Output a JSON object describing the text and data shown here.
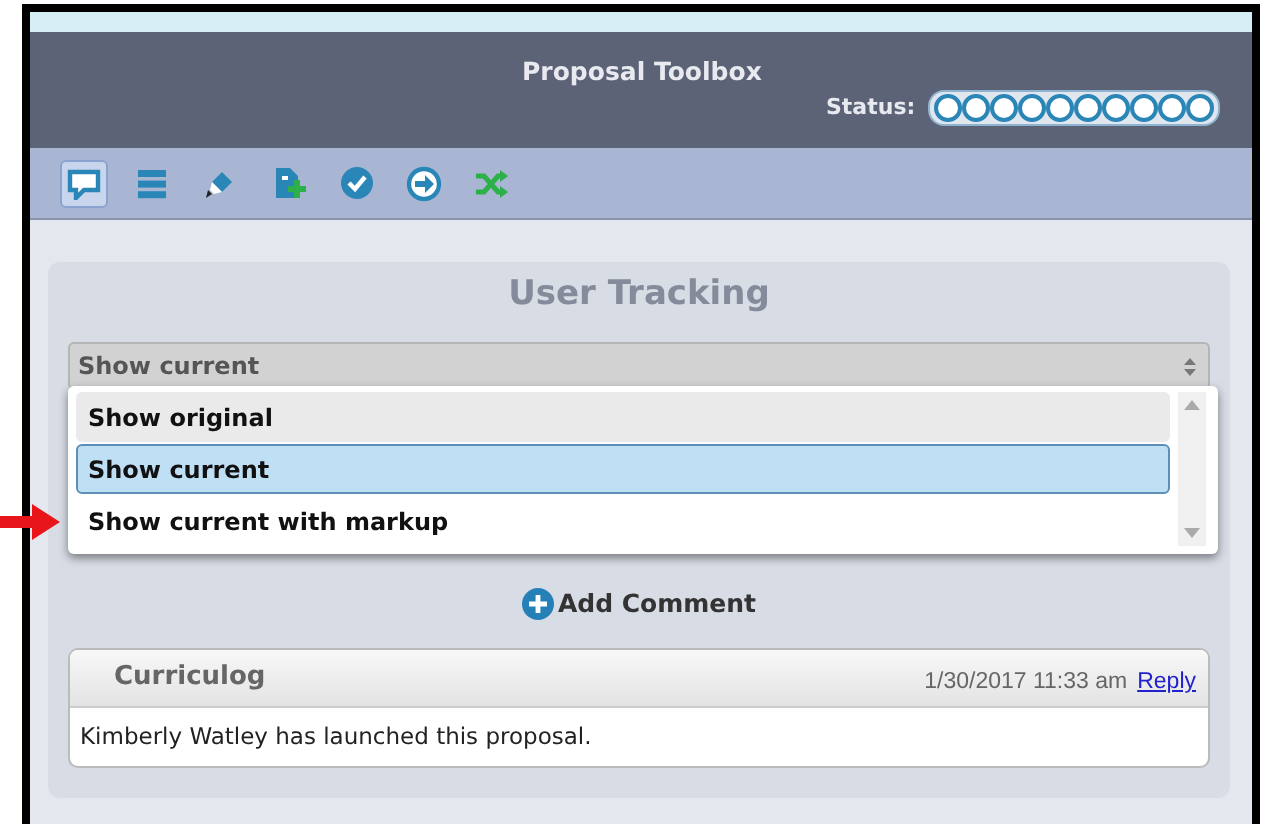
{
  "header": {
    "title": "Proposal Toolbox",
    "status_label": "Status:",
    "status_steps": [
      {
        "done": false
      },
      {
        "done": false
      },
      {
        "done": false
      },
      {
        "done": false
      },
      {
        "done": false
      },
      {
        "done": false
      },
      {
        "done": false
      },
      {
        "done": false
      },
      {
        "done": false
      },
      {
        "done": false
      }
    ]
  },
  "toolbar": [
    {
      "kind": "comment",
      "selected": true
    },
    {
      "kind": "list",
      "selected": false
    },
    {
      "kind": "pencil",
      "selected": false
    },
    {
      "kind": "add-file",
      "selected": false
    },
    {
      "kind": "check",
      "selected": false
    },
    {
      "kind": "arrow",
      "selected": false
    },
    {
      "kind": "shuffle",
      "selected": false
    }
  ],
  "panel": {
    "title": "User Tracking",
    "select_value": "Show current",
    "options": [
      {
        "label": "Show original",
        "selected": false
      },
      {
        "label": "Show current",
        "selected": true
      },
      {
        "label": "Show current with markup",
        "selected": false
      }
    ],
    "add_comment": "Add Comment",
    "comments": [
      {
        "author": "Curriculog",
        "time": "1/30/2017 11:33 am",
        "reply": "Reply",
        "text": "Kimberly Watley has launched this proposal."
      }
    ]
  }
}
